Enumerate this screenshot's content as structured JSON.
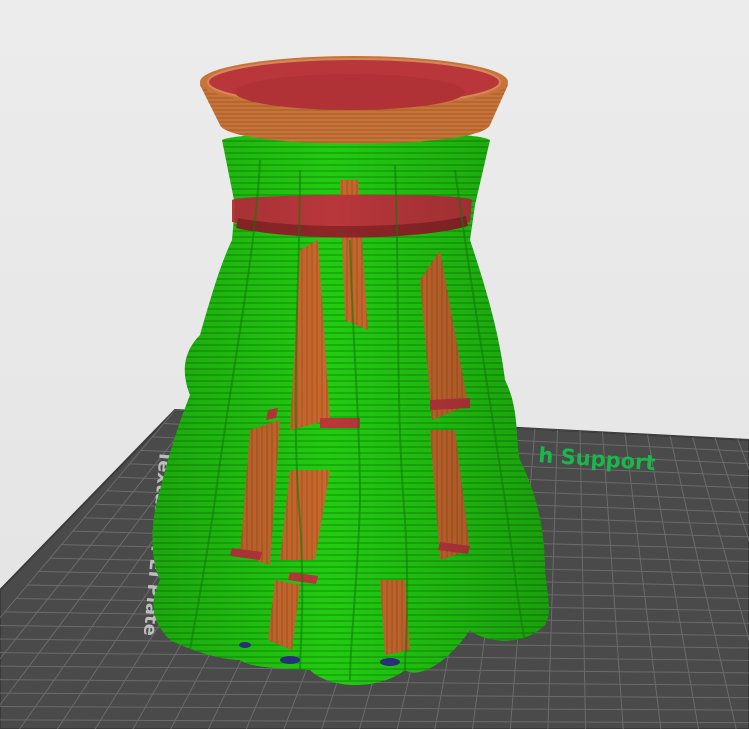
{
  "viewport": {
    "background": "#e8e8e8",
    "plate": {
      "surface_color": "#4a4a4a",
      "grid_color": "#6b6b6b",
      "edge_color": "#3a3a3a",
      "label_left": "Textured PEI Plate",
      "label_right": "h Support",
      "label_right_color": "#19b84a",
      "label_left_color": "#bdbdbd"
    },
    "model": {
      "support_color": "#22cc11",
      "wall_color": "#c8692e",
      "top_surface_color": "#b9373b",
      "rim_color": "#c87438",
      "base_color": "#2a2f7a"
    }
  }
}
